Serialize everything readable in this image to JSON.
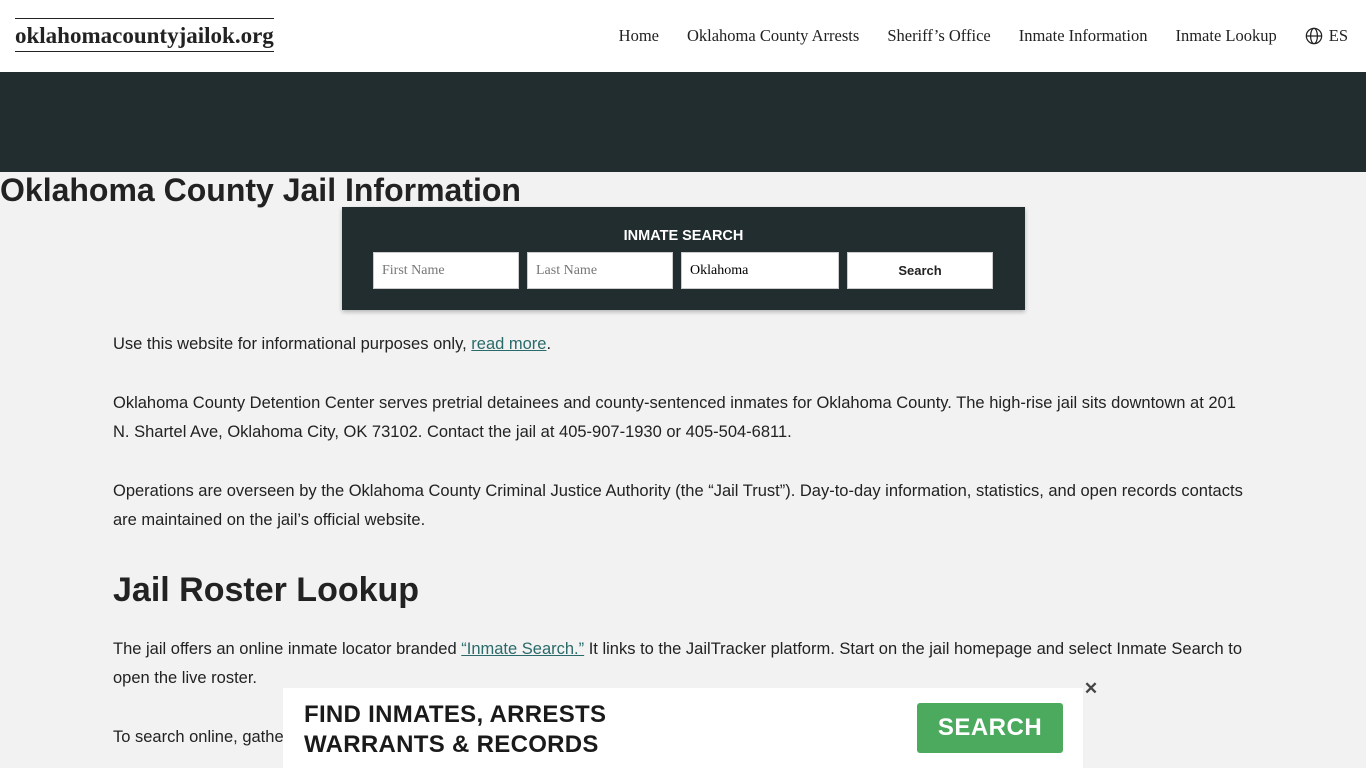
{
  "header": {
    "logo": "oklahomacountyjailok.org",
    "nav": [
      "Home",
      "Oklahoma County Arrests",
      "Sheriff’s Office",
      "Inmate Information",
      "Inmate Lookup"
    ],
    "lang": "ES"
  },
  "hero": {
    "title": "Oklahoma County Jail Information"
  },
  "search": {
    "title": "INMATE SEARCH",
    "first_placeholder": "First Name",
    "last_placeholder": "Last Name",
    "county_value": "Oklahoma",
    "button": "Search"
  },
  "content": {
    "p1_text": "Use this website for informational purposes only, ",
    "p1_link": "read more",
    "p1_end": ".",
    "p2": "Oklahoma County Detention Center serves pretrial detainees and county-sentenced inmates for Oklahoma County. The high-rise jail sits downtown at 201 N. Shartel Ave, Oklahoma City, OK 73102. Contact the jail at 405-907-1930 or 405-504-6811.",
    "p3": "Operations are overseen by the Oklahoma County Criminal Justice Authority (the “Jail Trust”). Day-to-day information, statistics, and open records contacts are maintained on the jail’s official website.",
    "h2": "Jail Roster Lookup",
    "p4_start": "The jail offers an online inmate locator branded ",
    "p4_link": "“Inmate Search.”",
    "p4_end": " It links to the JailTracker platform. Start on the jail homepage and select Inmate Search to open the live roster.",
    "p5": "To search online, gathe"
  },
  "ad": {
    "line1": "FIND INMATES, ARRESTS",
    "line2": "WARRANTS & RECORDS",
    "button": "SEARCH",
    "close": "✕"
  },
  "colors": {
    "dark": "#212d2e",
    "link": "#2b6a6a",
    "ad_button": "#4caa5e",
    "background": "#f2f2f2"
  },
  "icons": {
    "lang": "globe-icon",
    "close": "close-icon"
  }
}
